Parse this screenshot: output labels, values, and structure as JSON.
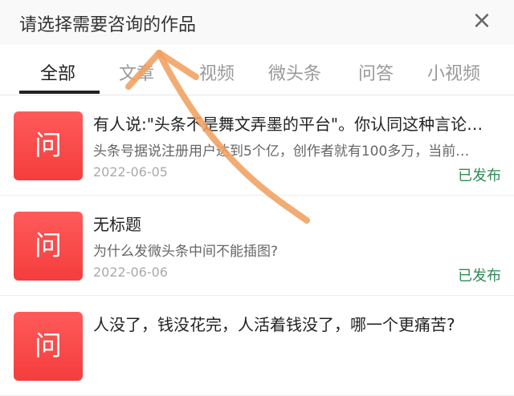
{
  "header": {
    "title": "请选择需要咨询的作品"
  },
  "tabs": [
    {
      "label": "全部"
    },
    {
      "label": "文章"
    },
    {
      "label": "视频"
    },
    {
      "label": "微头条"
    },
    {
      "label": "问答"
    },
    {
      "label": "小视频"
    }
  ],
  "items": [
    {
      "thumb_icon": "问",
      "title": "有人说:\"头条不是舞文弄墨的平台\"。你认同这种言论吗？",
      "desc": "头条号据说注册用户达到5个亿，创作者就有100多万，当前…",
      "date": "2022-06-05",
      "status": "已发布"
    },
    {
      "thumb_icon": "问",
      "title": "无标题",
      "desc": "为什么发微头条中间不能插图?",
      "date": "2022-06-06",
      "status": "已发布"
    },
    {
      "thumb_icon": "问",
      "title": "人没了，钱没花完，人活着钱没了，哪一个更痛苦?",
      "desc": "",
      "date": "",
      "status": ""
    }
  ],
  "colors": {
    "accent_red": "#f53d3d",
    "status_green": "#2e8b57",
    "annotation_orange": "#f0a060"
  }
}
